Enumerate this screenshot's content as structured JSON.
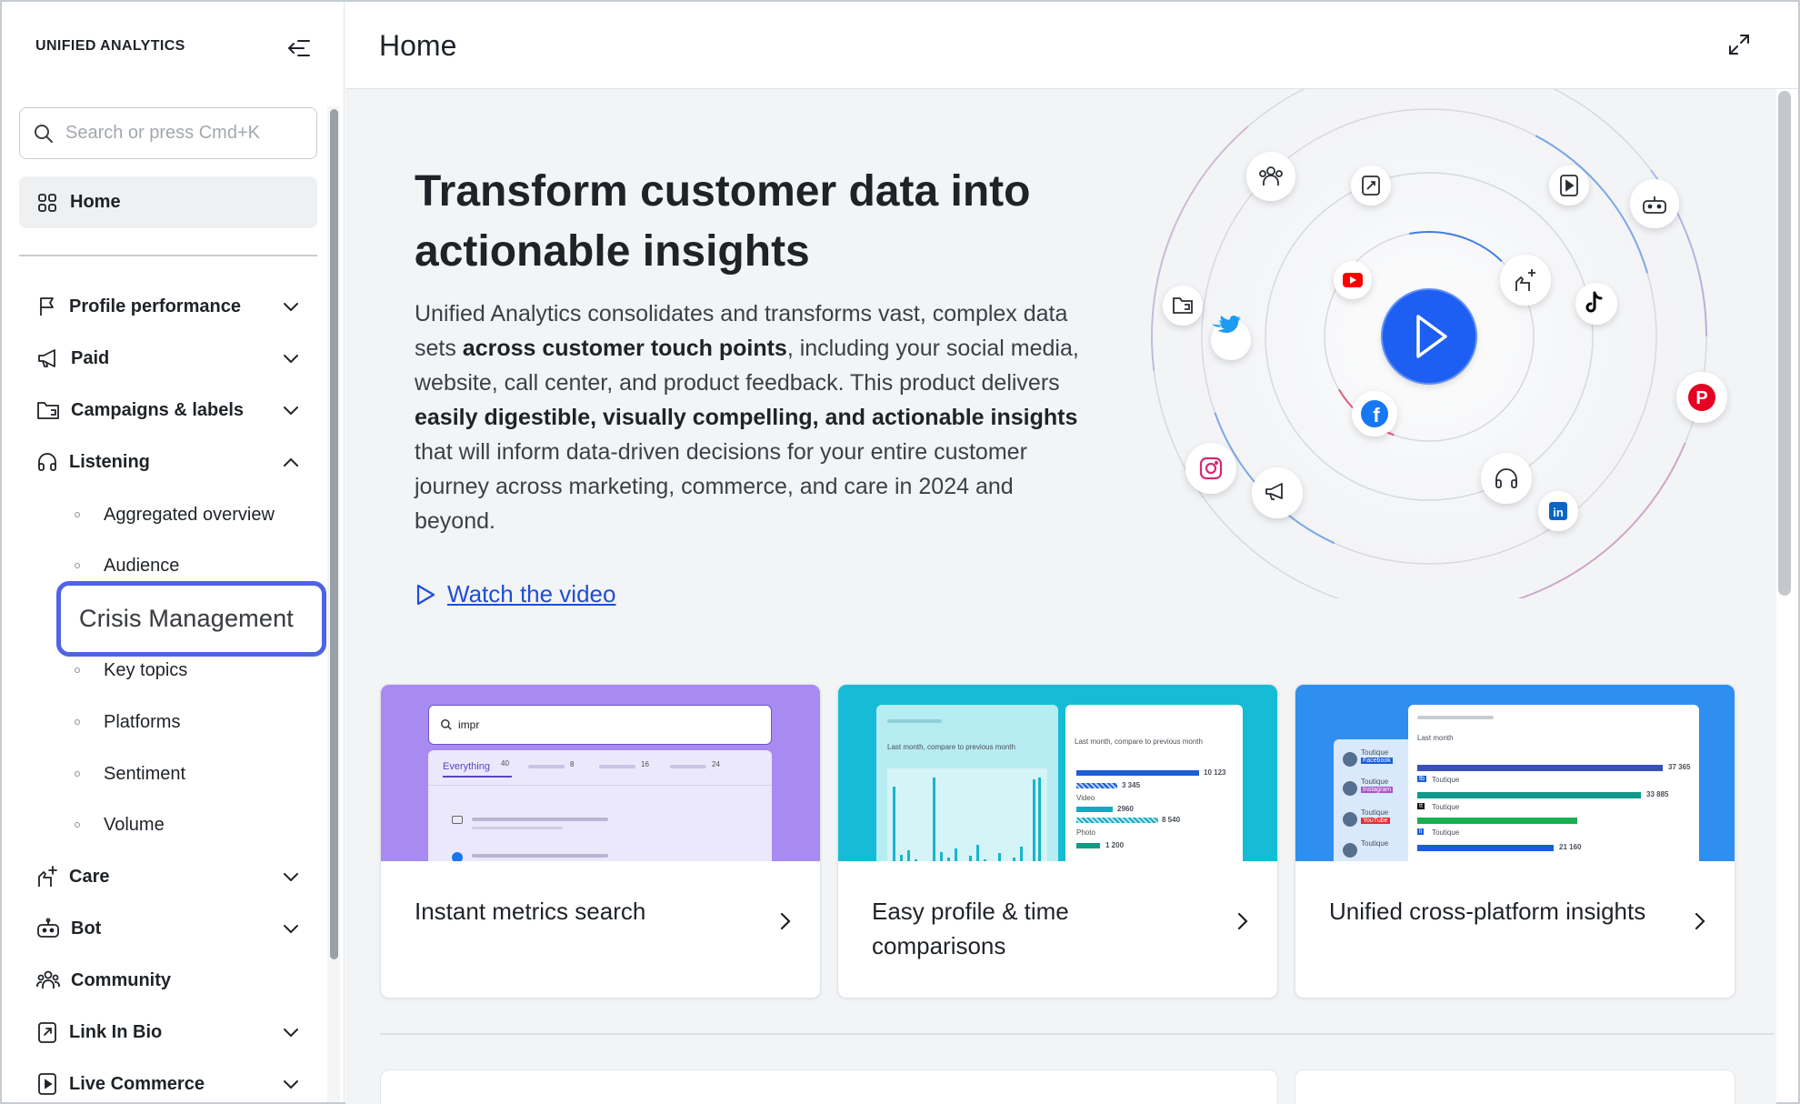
{
  "sidebar": {
    "brand": "UNIFIED ANALYTICS",
    "search_placeholder": "Search or press Cmd+K",
    "home_label": "Home",
    "nav": [
      {
        "label": "Profile performance"
      },
      {
        "label": "Paid"
      },
      {
        "label": "Campaigns & labels"
      },
      {
        "label": "Listening"
      },
      {
        "label": "Care"
      },
      {
        "label": "Bot"
      },
      {
        "label": "Community"
      },
      {
        "label": "Link In Bio"
      },
      {
        "label": "Live Commerce"
      }
    ],
    "listening_sub": [
      "Aggregated overview",
      "Audience",
      "Crisis Management",
      "Key topics",
      "Platforms",
      "Sentiment",
      "Volume"
    ]
  },
  "header": {
    "title": "Home"
  },
  "hero": {
    "title": "Transform customer data into actionable insights",
    "desc_1": "Unified Analytics consolidates and transforms vast, complex data sets ",
    "desc_b1": "across customer touch points",
    "desc_2": ", including your social media, website, call center, and product feedback. This product delivers ",
    "desc_b2": "easily digestible, visually compelling, and actionable insights",
    "desc_3": " that will inform data-driven decisions for your entire customer journey across marketing, commerce, and care in 2024 and beyond.",
    "watch_label": "Watch the video"
  },
  "cards": [
    {
      "title": "Instant metrics search",
      "preview": {
        "query": "impr",
        "tab_everything": "Everything",
        "count_everything": "40",
        "count_2": "8",
        "count_3": "16",
        "count_4": "24"
      }
    },
    {
      "title": "Easy profile & time comparisons",
      "preview": {
        "panel_label": "Last month, compare to previous month",
        "v1": "10 123",
        "v2": "3 345",
        "l_video": "Video",
        "v3": "2960",
        "v4": "8 540",
        "l_photo": "Photo",
        "v5": "1 200"
      }
    },
    {
      "title": "Unified cross-platform insights",
      "preview": {
        "panel_label": "Last month",
        "brand": "Toutique",
        "sub_fb": "Facebook",
        "sub_ig": "Instagram",
        "sub_yt": "YouTube",
        "v1": "37 365",
        "v2": "33 885",
        "v3": "21 160"
      }
    }
  ],
  "colors": {
    "accent_focus": "#4f63e6",
    "link": "#1d4ed8",
    "play_button": "#1f5ff2",
    "card1_bg": "#a78bf0",
    "card2_bg": "#16bcd6",
    "card3_bg": "#2f8ff0"
  }
}
